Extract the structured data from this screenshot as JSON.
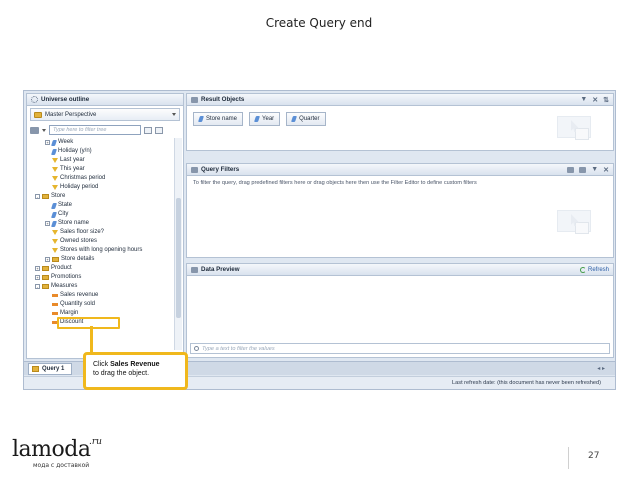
{
  "slide": {
    "title": "Create Query end",
    "page_number": "27"
  },
  "logo": {
    "brand": "lamoda",
    "suffix": ".ru",
    "tagline": "мода с доставкой"
  },
  "universe_outline": {
    "title": "Universe outline",
    "perspective": "Master Perspective",
    "tree_filter_placeholder": "Type here to filter tree",
    "tree": [
      {
        "label": "Week",
        "icon": "dim",
        "level": 1,
        "expander": "+"
      },
      {
        "label": "Holiday (y/n)",
        "icon": "dim",
        "level": 1,
        "expander": ""
      },
      {
        "label": "Last year",
        "icon": "filter",
        "level": 1,
        "expander": ""
      },
      {
        "label": "This year",
        "icon": "filter",
        "level": 1,
        "expander": ""
      },
      {
        "label": "Christmas period",
        "icon": "filter",
        "level": 1,
        "expander": ""
      },
      {
        "label": "Holiday period",
        "icon": "filter",
        "level": 1,
        "expander": ""
      },
      {
        "label": "Store",
        "icon": "folder",
        "level": 0,
        "expander": "-"
      },
      {
        "label": "State",
        "icon": "dim",
        "level": 1,
        "expander": ""
      },
      {
        "label": "City",
        "icon": "dim",
        "level": 1,
        "expander": ""
      },
      {
        "label": "Store name",
        "icon": "dim",
        "level": 1,
        "expander": "+"
      },
      {
        "label": "Sales floor size?",
        "icon": "filter",
        "level": 1,
        "expander": ""
      },
      {
        "label": "Owned stores",
        "icon": "filter",
        "level": 1,
        "expander": ""
      },
      {
        "label": "Stores with long opening hours",
        "icon": "filter",
        "level": 1,
        "expander": ""
      },
      {
        "label": "Store details",
        "icon": "folder",
        "level": 1,
        "expander": "+"
      },
      {
        "label": "Product",
        "icon": "folder",
        "level": 0,
        "expander": "+"
      },
      {
        "label": "Promotions",
        "icon": "folder",
        "level": 0,
        "expander": "+"
      },
      {
        "label": "Measures",
        "icon": "folder",
        "level": 0,
        "expander": "-"
      },
      {
        "label": "Sales revenue",
        "icon": "measure",
        "level": 1,
        "expander": ""
      },
      {
        "label": "Quantity sold",
        "icon": "measure",
        "level": 1,
        "expander": ""
      },
      {
        "label": "Margin",
        "icon": "measure",
        "level": 1,
        "expander": ""
      },
      {
        "label": "Discount",
        "icon": "measure",
        "level": 1,
        "expander": ""
      }
    ]
  },
  "callout": {
    "line1_pre": "Click ",
    "line1_bold": "Sales Revenue",
    "line2": "to drag the object."
  },
  "result_objects": {
    "title": "Result Objects",
    "chips": [
      "Store name",
      "Year",
      "Quarter"
    ]
  },
  "query_filters": {
    "title": "Query Filters",
    "hint": "To filter the query, drag predefined filters here or drag objects here then use the Filter Editor to define custom filters"
  },
  "data_preview": {
    "title": "Data Preview",
    "refresh_label": "Refresh",
    "search_placeholder": "Type a text to filter the values"
  },
  "bottom": {
    "tab_label": "Query 1",
    "status": "Last refresh date: (this document has never been refreshed)"
  }
}
